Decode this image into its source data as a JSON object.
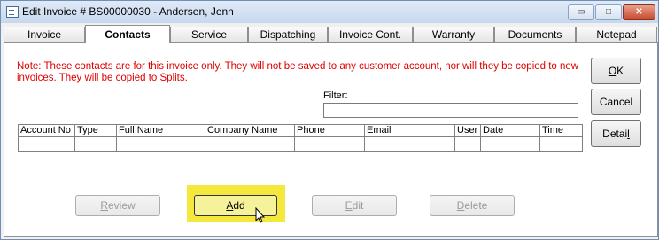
{
  "window": {
    "title": "Edit Invoice # BS00000030  -  Andersen, Jenn",
    "controls": {
      "minimize": "▭",
      "maximize": "□",
      "close": "✕"
    }
  },
  "tabs": [
    "Invoice",
    "Contacts",
    "Service",
    "Dispatching",
    "Invoice Cont.",
    "Warranty",
    "Documents",
    "Notepad"
  ],
  "active_tab": "Contacts",
  "note": "Note: These contacts are for this invoice only. They will not be saved to any customer account, nor will they be copied to new invoices. They will be copied to Splits.",
  "filter": {
    "label": "Filter:",
    "value": ""
  },
  "grid": {
    "columns": [
      "Account No",
      "Type",
      "Full Name",
      "Company Name",
      "Phone",
      "Email",
      "User",
      "Date",
      "Time"
    ],
    "rows": []
  },
  "side_buttons": {
    "ok": {
      "pre": "",
      "key": "O",
      "post": "K"
    },
    "cancel": {
      "pre": "",
      "key": "",
      "post": "Cancel"
    },
    "detail": {
      "pre": "Detai",
      "key": "l",
      "post": ""
    }
  },
  "bottom_buttons": {
    "review": {
      "pre": "",
      "key": "R",
      "post": "eview",
      "enabled": false
    },
    "add": {
      "pre": "",
      "key": "A",
      "post": "dd",
      "enabled": true,
      "highlighted": true
    },
    "edit": {
      "pre": "",
      "key": "E",
      "post": "dit",
      "enabled": false
    },
    "delete": {
      "pre": "",
      "key": "D",
      "post": "elete",
      "enabled": false
    }
  },
  "colors": {
    "note_text": "#e00000",
    "highlight": "#f3e83b"
  }
}
